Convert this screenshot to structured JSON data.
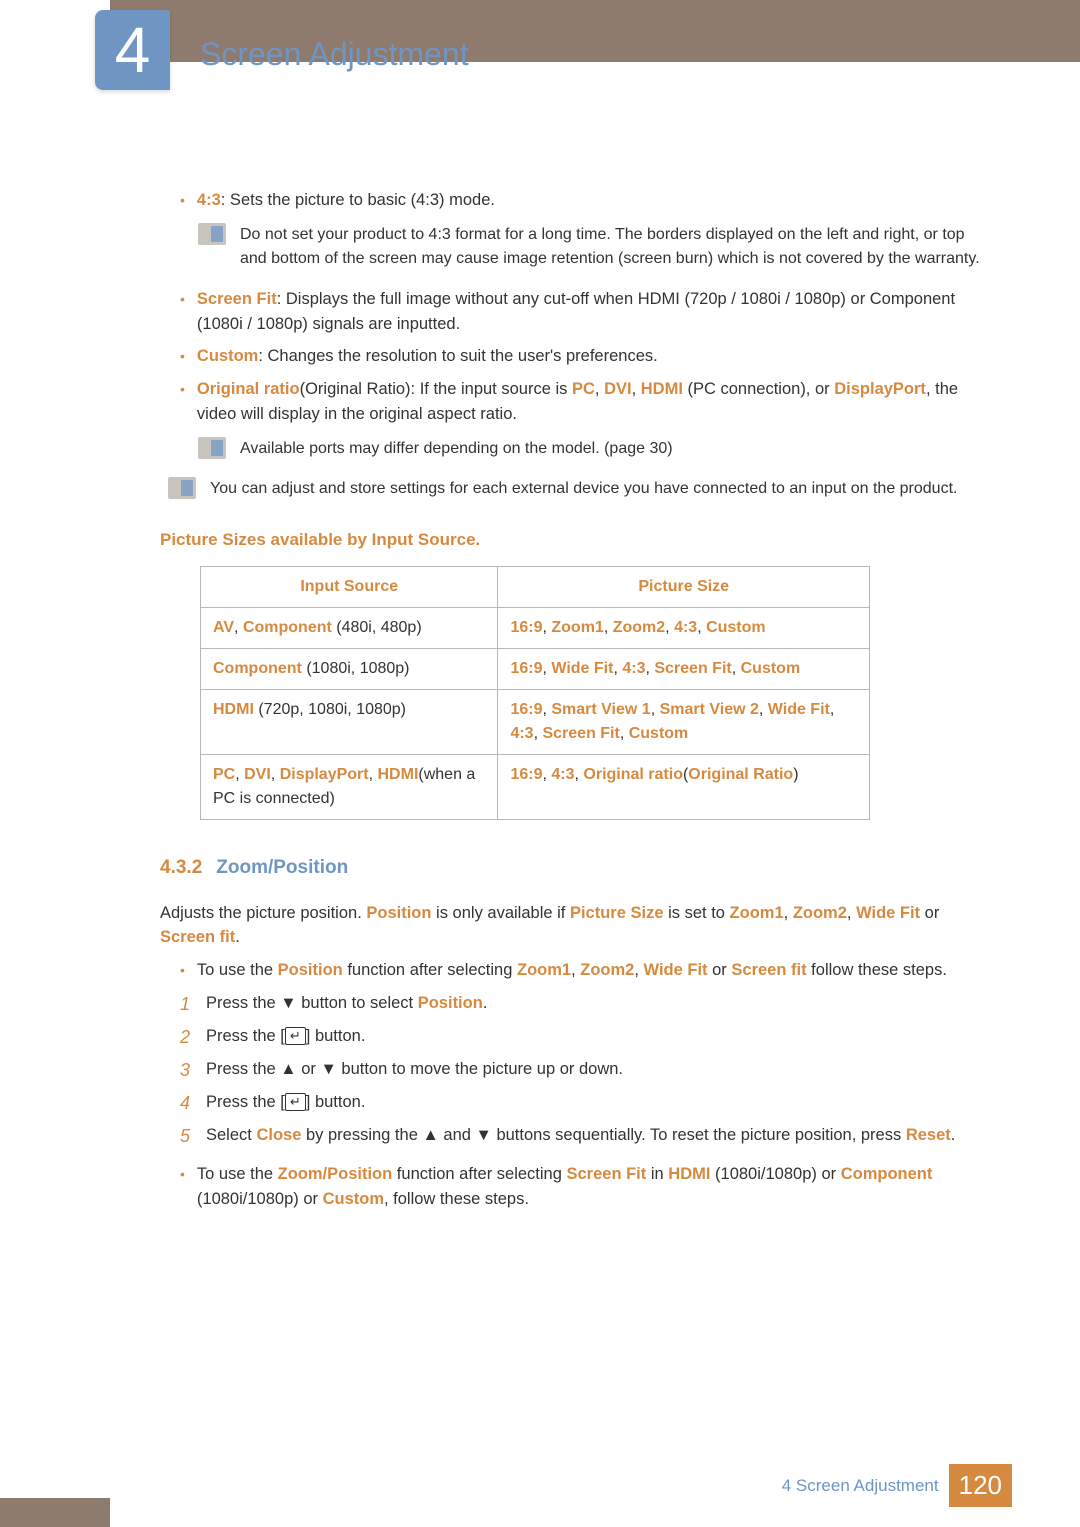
{
  "chapter": {
    "number": "4",
    "title": "Screen Adjustment"
  },
  "bullets": [
    {
      "term": "4:3",
      "text": ": Sets the picture to basic (4:3) mode."
    },
    {
      "term": "Screen Fit",
      "text": ": Displays the full image without any cut-off when HDMI (720p / 1080i / 1080p) or Component (1080i / 1080p) signals are inputted."
    },
    {
      "term": "Custom",
      "text": ": Changes the resolution to suit the user's preferences."
    },
    {
      "term": "Original ratio",
      "paren": "(Original Ratio)",
      "text_html": ": If the input source is <b class='orange'>PC</b>, <b class='orange'>DVI</b>, <b class='orange'>HDMI</b> (PC connection), or <b class='orange'>DisplayPort</b>, the video will display in the original aspect ratio."
    }
  ],
  "notes": {
    "burn": "Do not set your product to 4:3 format for a long time. The borders displayed on the left and right, or top and bottom of the screen may cause image retention (screen burn) which is not covered by the warranty.",
    "ports": "Available ports may differ depending on the model. (page 30)",
    "store": "You can adjust and store settings for each external device you have connected to an input on the product."
  },
  "table": {
    "heading": "Picture Sizes available by Input Source.",
    "cols": [
      "Input Source",
      "Picture Size"
    ],
    "rows": [
      {
        "src_html": "<b class='orange'>AV</b>, <b class='orange'>Component</b> (480i, 480p)",
        "ps_html": "<b class='orange'>16:9</b>, <b class='orange'>Zoom1</b>, <b class='orange'>Zoom2</b>, <b class='orange'>4:3</b>, <b class='orange'>Custom</b>"
      },
      {
        "src_html": "<b class='orange'>Component</b> (1080i, 1080p)",
        "ps_html": "<b class='orange'>16:9</b>, <b class='orange'>Wide Fit</b>, <b class='orange'>4:3</b>, <b class='orange'>Screen Fit</b>, <b class='orange'>Custom</b>"
      },
      {
        "src_html": "<b class='orange'>HDMI</b> (720p, 1080i, 1080p)",
        "ps_html": "<b class='orange'>16:9</b>, <b class='orange'>Smart View 1</b>, <b class='orange'>Smart View 2</b>, <b class='orange'>Wide Fit</b>, <b class='orange'>4:3</b>, <b class='orange'>Screen Fit</b>, <b class='orange'>Custom</b>"
      },
      {
        "src_html": "<b class='orange'>PC</b>, <b class='orange'>DVI</b>, <b class='orange'>DisplayPort</b>, <b class='orange'>HDMI</b>(when a PC is connected)",
        "ps_html": "<b class='orange'>16:9</b>, <b class='orange'>4:3</b>, <b class='orange'>Original ratio</b>(<b class='orange'>Original Ratio</b>)"
      }
    ]
  },
  "section": {
    "num": "4.3.2",
    "title": "Zoom/Position"
  },
  "zoom": {
    "intro_html": "Adjusts the picture position. <b class='orange'>Position</b> is only available if <b class='orange'>Picture Size</b> is set to <b class='orange'>Zoom1</b>, <b class='orange'>Zoom2</b>, <b class='orange'>Wide Fit</b> or <b class='orange'>Screen fit</b>.",
    "lead_html": "To use the <b class='orange'>Position</b> function after selecting <b class='orange'>Zoom1</b>, <b class='orange'>Zoom2</b>, <b class='orange'>Wide Fit</b> or <b class='orange'>Screen fit</b> follow these steps.",
    "steps": [
      "Press the <span class='arrow'>▼</span> button to select <b class='orange'>Position</b>.",
      "Press the [<span class='btn-icon'>↵</span>] button.",
      "Press the <span class='arrow'>▲</span> or <span class='arrow'>▼</span> button to move the picture up or down.",
      "Press the [<span class='btn-icon'>↵</span>] button.",
      "Select <b class='orange'>Close</b> by pressing the <span class='arrow'>▲</span> and <span class='arrow'>▼</span> buttons sequentially. To reset the picture position, press <b class='orange'>Reset</b>."
    ],
    "after_html": "To use the <b class='orange'>Zoom/Position</b> function after selecting <b class='orange'>Screen Fit</b> in <b class='orange'>HDMI</b> (1080i/1080p) or <b class='orange'>Component</b> (1080i/1080p) or <b class='orange'>Custom</b>, follow these steps."
  },
  "footer": {
    "label": "4 Screen Adjustment",
    "page": "120"
  }
}
